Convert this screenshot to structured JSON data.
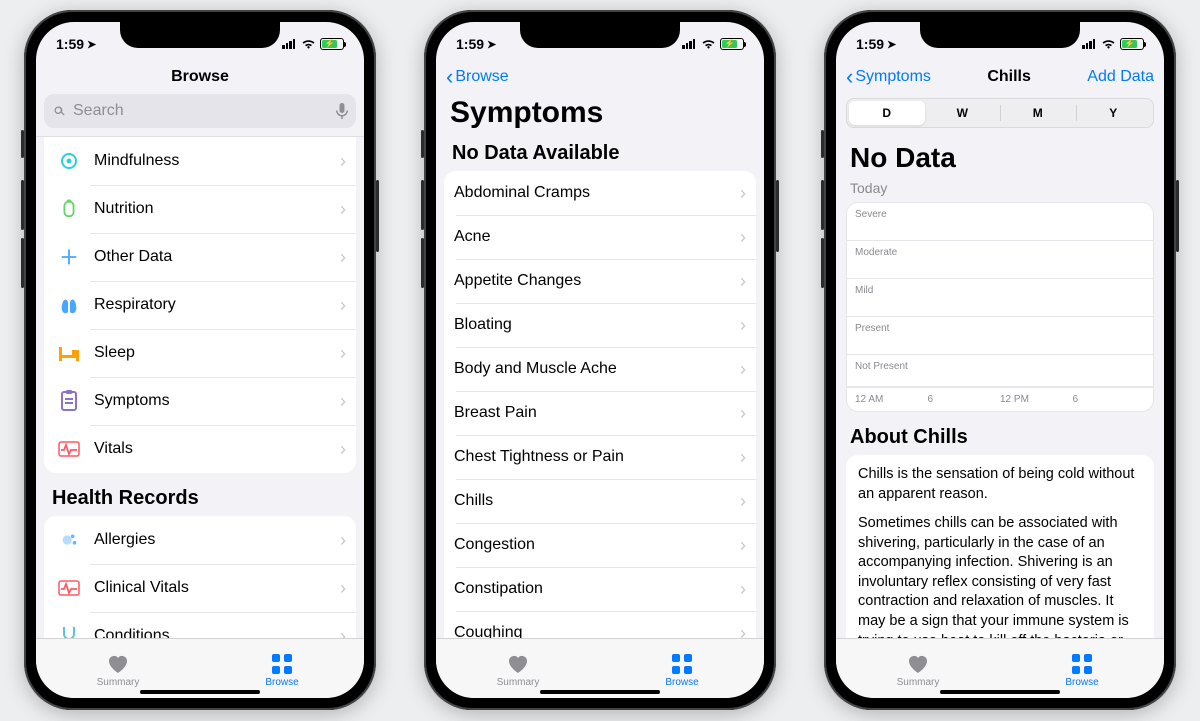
{
  "status": {
    "time": "1:59"
  },
  "tabs": {
    "summary": "Summary",
    "browse": "Browse"
  },
  "screen1": {
    "title": "Browse",
    "search_placeholder": "Search",
    "categories": [
      {
        "label": "Mindfulness"
      },
      {
        "label": "Nutrition"
      },
      {
        "label": "Other Data"
      },
      {
        "label": "Respiratory"
      },
      {
        "label": "Sleep"
      },
      {
        "label": "Symptoms"
      },
      {
        "label": "Vitals"
      }
    ],
    "records_header": "Health Records",
    "records": [
      {
        "label": "Allergies"
      },
      {
        "label": "Clinical Vitals"
      },
      {
        "label": "Conditions"
      }
    ]
  },
  "screen2": {
    "back": "Browse",
    "title": "Symptoms",
    "section_header": "No Data Available",
    "items": [
      "Abdominal Cramps",
      "Acne",
      "Appetite Changes",
      "Bloating",
      "Body and Muscle Ache",
      "Breast Pain",
      "Chest Tightness or Pain",
      "Chills",
      "Congestion",
      "Constipation",
      "Coughing"
    ]
  },
  "screen3": {
    "back": "Symptoms",
    "title": "Chills",
    "action": "Add Data",
    "segments": [
      "D",
      "W",
      "M",
      "Y"
    ],
    "selected_segment": 0,
    "empty_title": "No Data",
    "sub_label": "Today",
    "y_labels": [
      "Severe",
      "Moderate",
      "Mild",
      "Present",
      "Not Present"
    ],
    "x_labels": [
      "12 AM",
      "6",
      "12 PM",
      "6"
    ],
    "about_header": "About Chills",
    "about_p1": "Chills is the sensation of being cold without an apparent reason.",
    "about_p2": "Sometimes chills can be associated with shivering, particularly in the case of an accompanying infection. Shivering is an involuntary reflex consisting of very fast contraction and relaxation of muscles. It may be a sign that your immune system is trying to use heat to kill off the bacteria or virus"
  },
  "chart_data": {
    "type": "bar",
    "title": "Chills",
    "categories": [
      "12 AM",
      "6",
      "12 PM",
      "6"
    ],
    "y_categories": [
      "Not Present",
      "Present",
      "Mild",
      "Moderate",
      "Severe"
    ],
    "series": [
      {
        "name": "Chills",
        "values": []
      }
    ],
    "note": "No Data"
  }
}
